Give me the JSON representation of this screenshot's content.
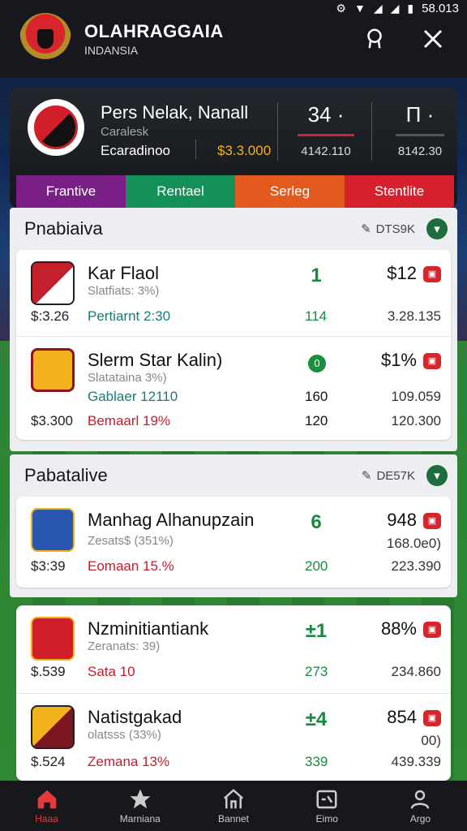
{
  "status_bar": {
    "time": "58.013"
  },
  "header": {
    "title": "OLAHRAGGAIA",
    "subtitle": "INDANSIA",
    "colors": {
      "bg": "#16181d"
    }
  },
  "summary": {
    "club_name": "Pers Nelak, Nanall",
    "meta": "Caralesk",
    "status": "Ecaradinoo",
    "value": "$3.3.000",
    "stat1": {
      "big": "34 ·",
      "small": "4142.110"
    },
    "stat2": {
      "big": "Π ·",
      "small": "8142.30"
    }
  },
  "tabs": [
    {
      "label": "Frantive",
      "color": "#7a1f86"
    },
    {
      "label": "Rentael",
      "color": "#149159"
    },
    {
      "label": "Serleg",
      "color": "#e35a1e"
    },
    {
      "label": "Stentlite",
      "color": "#d6202d"
    }
  ],
  "sections": [
    {
      "label": "Pnabiaiva",
      "tag": "DTS9K",
      "rows": [
        {
          "name": "Kar Flaol",
          "meta": "Slatfiats: 3%)",
          "p1": "Pertiarnt 2:30",
          "p2": "",
          "left_top": "$:3.26",
          "left_bottom": "",
          "score": "1",
          "price": "$12",
          "num1": "114",
          "num2": "",
          "r1": "3.28.135",
          "r2": ""
        },
        {
          "name": "Slerm Star Kalin)",
          "meta": "Slatataina 3%)",
          "p1": "Gablaer 12110",
          "p2": "Bemaarl 19%",
          "left_top": "",
          "left_bottom": "$3.300",
          "score": "0",
          "price": "$1%",
          "num1": "160",
          "num2": "120",
          "r1": "109.059",
          "r2": "120.300"
        }
      ]
    },
    {
      "label": "Pabatalive",
      "tag": "DE57K",
      "rows": [
        {
          "name": "Manhag Alhanupzain",
          "meta": "Zesats$ (351%)",
          "p1": "Eomaan 15.%",
          "p2": "",
          "left_top": "$3:39",
          "left_bottom": "",
          "score": "6",
          "price": "948",
          "num1": "200",
          "num2": "",
          "r1": "168.0e0)",
          "r2": "223.390"
        }
      ]
    },
    {
      "label": "",
      "tag": "",
      "rows": [
        {
          "name": "Nzminitiantiank",
          "meta": "Zeranats: 39)",
          "p1": "Sata 10",
          "p2": "",
          "left_top": "$.539",
          "left_bottom": "",
          "score": "±1",
          "price": "88%",
          "num1": "273",
          "num2": "",
          "r1": "234.860",
          "r2": ""
        },
        {
          "name": "Natistgakad",
          "meta": "olatsss (33%)",
          "p1": "Zemana 13%",
          "p2": "",
          "left_top": "$.524",
          "left_bottom": "",
          "score": "±4",
          "price": "854",
          "num1": "339",
          "num2": "",
          "r1": "00)",
          "r2": "439.339"
        }
      ]
    }
  ],
  "bottom_nav": [
    {
      "label": "Haaa",
      "icon": "home-icon",
      "active": true
    },
    {
      "label": "Marniana",
      "icon": "star-icon",
      "active": false
    },
    {
      "label": "Bannet",
      "icon": "stadium-icon",
      "active": false
    },
    {
      "label": "Eimo",
      "icon": "scoreboard-icon",
      "active": false
    },
    {
      "label": "Argo",
      "icon": "user-icon",
      "active": false
    }
  ]
}
